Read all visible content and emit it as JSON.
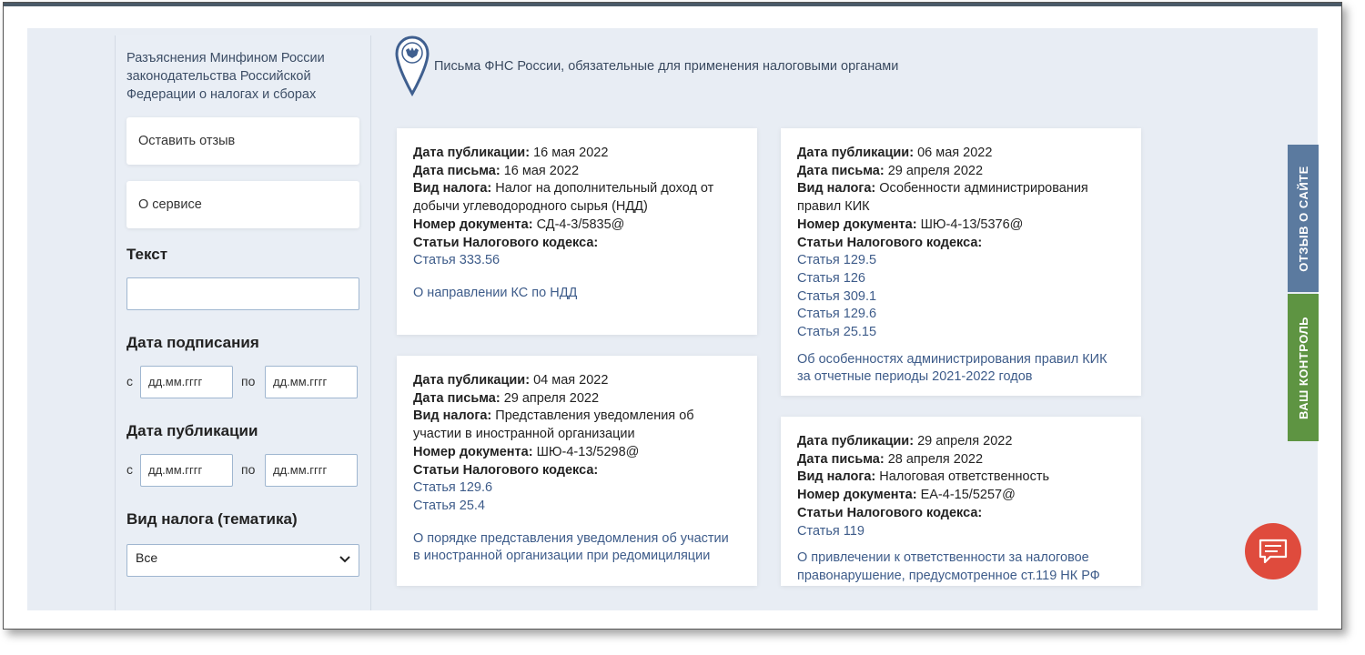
{
  "header": {
    "title": "Письма ФНС России, обязательные для применения налоговыми органами"
  },
  "sidebar": {
    "title": "Разъяснения Минфином России законодательства Российской Федерации о налогах и сборах",
    "buttons": {
      "feedback": "Оставить отзыв",
      "about": "О сервисе"
    },
    "text_label": "Текст",
    "text_value": "",
    "signing_label": "Дата подписания",
    "publication_label": "Дата публикации",
    "from": "с",
    "to": "по",
    "date_placeholder": "дд.мм.гггг",
    "tax_type_label": "Вид налога (тематика)",
    "tax_type_selected": "Все"
  },
  "labels": {
    "pub_date": "Дата публикации:",
    "letter_date": "Дата письма:",
    "tax_type": "Вид налога:",
    "doc_number": "Номер документа:",
    "articles": "Статьи Налогового кодекса:"
  },
  "cards": [
    {
      "pub_date": "16 мая 2022",
      "letter_date": "16 мая 2022",
      "tax_type_1": "Налог на дополнительный доход от",
      "tax_type_2": "добычи углеводородного сырья (НДД)",
      "doc_number": "СД-4-3/5835@",
      "articles": [
        "Статья 333.56"
      ],
      "desc_1": "О направлении КС по НДД",
      "desc_2": ""
    },
    {
      "pub_date": "04 мая 2022",
      "letter_date": "29 апреля 2022",
      "tax_type_1": "Представления уведомления об",
      "tax_type_2": "участии в иностранной организации",
      "doc_number": "ШЮ-4-13/5298@",
      "articles": [
        "Статья 129.6",
        "Статья 25.4"
      ],
      "desc_1": "О порядке представления уведомления об участии",
      "desc_2": "в иностранной организации при редомициляции"
    },
    {
      "pub_date": "06 мая 2022",
      "letter_date": "29 апреля 2022",
      "tax_type_1": "Особенности администрирования",
      "tax_type_2": "правил КИК",
      "doc_number": "ШЮ-4-13/5376@",
      "articles": [
        "Статья 129.5",
        "Статья 126",
        "Статья 309.1",
        "Статья 129.6",
        "Статья 25.15"
      ],
      "desc_1": "Об особенностях администрирования правил КИК",
      "desc_2": "за отчетные периоды 2021-2022 годов"
    },
    {
      "pub_date": "29 апреля 2022",
      "letter_date": "28 апреля 2022",
      "tax_type_1": "Налоговая ответственность",
      "tax_type_2": "",
      "doc_number": "ЕА-4-15/5257@",
      "articles": [
        "Статья 119"
      ],
      "desc_1": "О привлечении к ответственности за налоговое",
      "desc_2": "правонарушение, предусмотренное ст.119 НК РФ"
    }
  ],
  "side_tabs": {
    "feedback": "ОТЗЫВ О САЙТЕ",
    "control": "ВАШ КОНТРОЛЬ"
  },
  "icons": {
    "pin": "fns-emblem-pin-icon",
    "chevron": "chevron-down-icon",
    "chat": "chat-bubble-icon"
  },
  "colors": {
    "link": "#3e5c8a",
    "tab_feedback": "#5b7a9f",
    "tab_control": "#5e9442",
    "chat_button": "#df4b3d",
    "page_bg": "#e8edf4"
  }
}
